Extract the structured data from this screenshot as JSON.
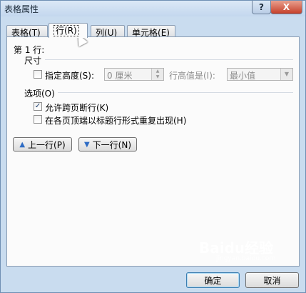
{
  "window": {
    "title": "表格属性",
    "help_label": "?",
    "close_label": "X"
  },
  "tabs": [
    {
      "label": "表格",
      "key": "(T)"
    },
    {
      "label": "行",
      "key": "(R)"
    },
    {
      "label": "列",
      "key": "(U)"
    },
    {
      "label": "单元格",
      "key": "(E)"
    }
  ],
  "row_panel": {
    "row_label": "第 1 行:",
    "size_group": "尺寸",
    "specify_height_label": "指定高度(S):",
    "height_value": "0 厘米",
    "row_height_is_label": "行高值是(I):",
    "row_height_mode": "最小值",
    "options_group": "选项(O)",
    "allow_break_label": "允许跨页断行(K)",
    "allow_break_checked": true,
    "repeat_header_label": "在各页顶端以标题行形式重复出现(H)",
    "repeat_header_checked": false,
    "specify_height_checked": false,
    "check_mark": "✓"
  },
  "nav_buttons": {
    "prev_label": "上一行(P)",
    "next_label": "下一行(N)",
    "prev_arrow": "▲",
    "next_arrow": "▼"
  },
  "footer": {
    "ok_label": "确定",
    "cancel_label": "取消"
  },
  "watermark": {
    "text": "Baidu经验",
    "sub": "jingyan.baidu.com"
  },
  "icons": {
    "spin_up": "▲",
    "spin_down": "▼",
    "dropdown": "▼"
  }
}
